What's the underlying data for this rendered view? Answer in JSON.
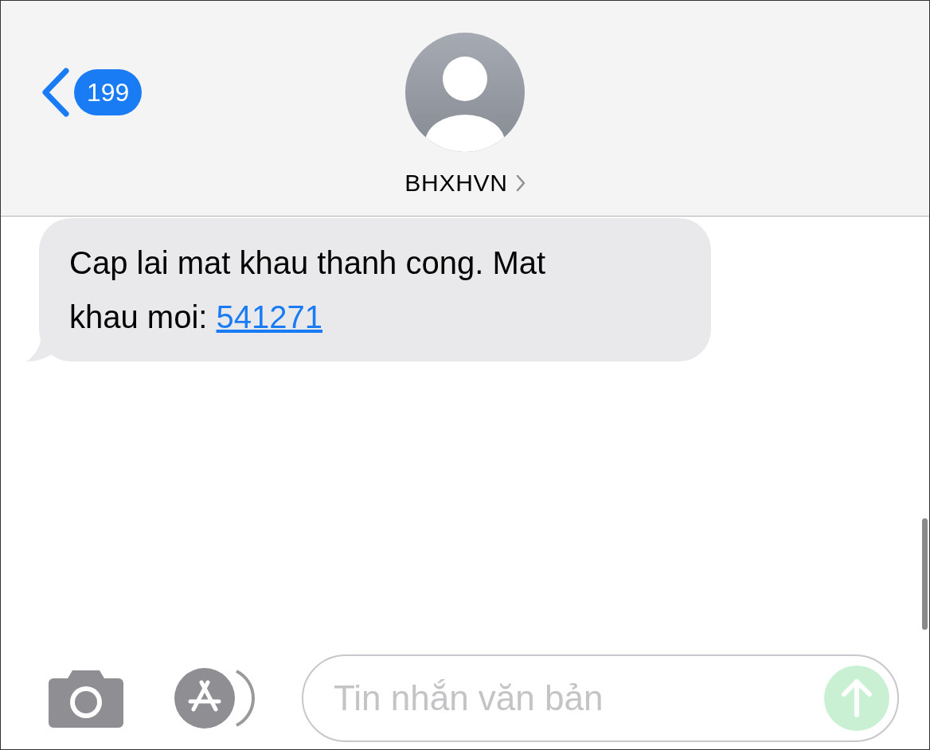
{
  "header": {
    "back_count": "199",
    "contact_name": "BHXHVN"
  },
  "messages": [
    {
      "text": "Cap lai mat khau thanh cong. Mat khau moi: ",
      "link": "541271"
    }
  ],
  "composer": {
    "placeholder": "Tin nhắn văn bản"
  }
}
